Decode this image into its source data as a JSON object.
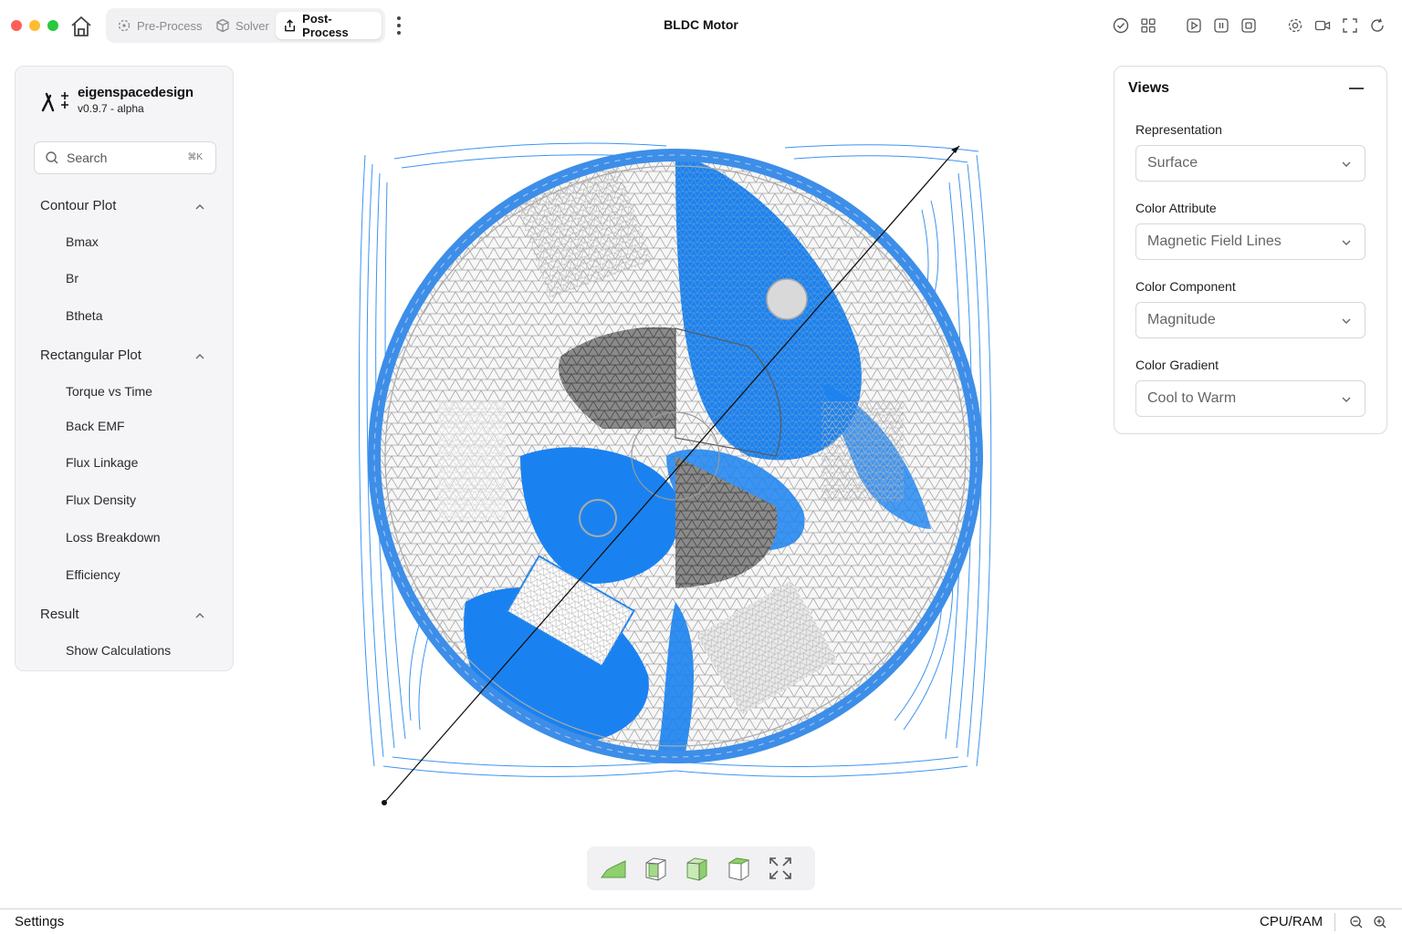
{
  "window": {
    "title": "BLDC Motor",
    "traffic_colors": [
      "#ff5f57",
      "#febc2e",
      "#28c840"
    ]
  },
  "tabs": [
    {
      "label": "Pre-Process",
      "icon": "preprocess-icon",
      "active": false
    },
    {
      "label": "Solver",
      "icon": "cube-icon",
      "active": false
    },
    {
      "label": "Post-Process",
      "icon": "export-icon",
      "active": true
    }
  ],
  "toolbar_icons": [
    "check-circle-icon",
    "grid-icon",
    "play-icon",
    "pause-icon",
    "stop-icon",
    "gear-icon",
    "video-icon",
    "fullscreen-icon",
    "refresh-icon"
  ],
  "sidebar": {
    "brand": "eigenspacedesign",
    "version": "v0.9.7 - alpha",
    "search": {
      "placeholder": "Search",
      "shortcut": "⌘K"
    },
    "sections": [
      {
        "title": "Contour Plot",
        "items": [
          "Bmax",
          "Br",
          "Btheta"
        ]
      },
      {
        "title": "Rectangular Plot",
        "items": [
          "Torque vs Time",
          "Back EMF",
          "Flux Linkage",
          "Flux Density",
          "Loss Breakdown",
          "Efficiency"
        ]
      },
      {
        "title": "Result",
        "items": [
          "Show Calculations"
        ]
      }
    ]
  },
  "views": {
    "title": "Views",
    "fields": [
      {
        "label": "Representation",
        "value": "Surface"
      },
      {
        "label": "Color Attribute",
        "value": "Magnetic Field Lines"
      },
      {
        "label": "Color Component",
        "value": "Magnitude"
      },
      {
        "label": "Color Gradient",
        "value": "Cool to Warm"
      }
    ]
  },
  "view_tools": [
    "surface-view-icon",
    "front-view-icon",
    "side-view-icon",
    "iso-view-icon",
    "fit-view-icon"
  ],
  "colors": {
    "field_lines": "#1a82f0",
    "mesh": "#a8a8a8",
    "mesh_dark": "#5a5a5a"
  },
  "statusbar": {
    "left": "Settings",
    "right": "CPU/RAM"
  }
}
